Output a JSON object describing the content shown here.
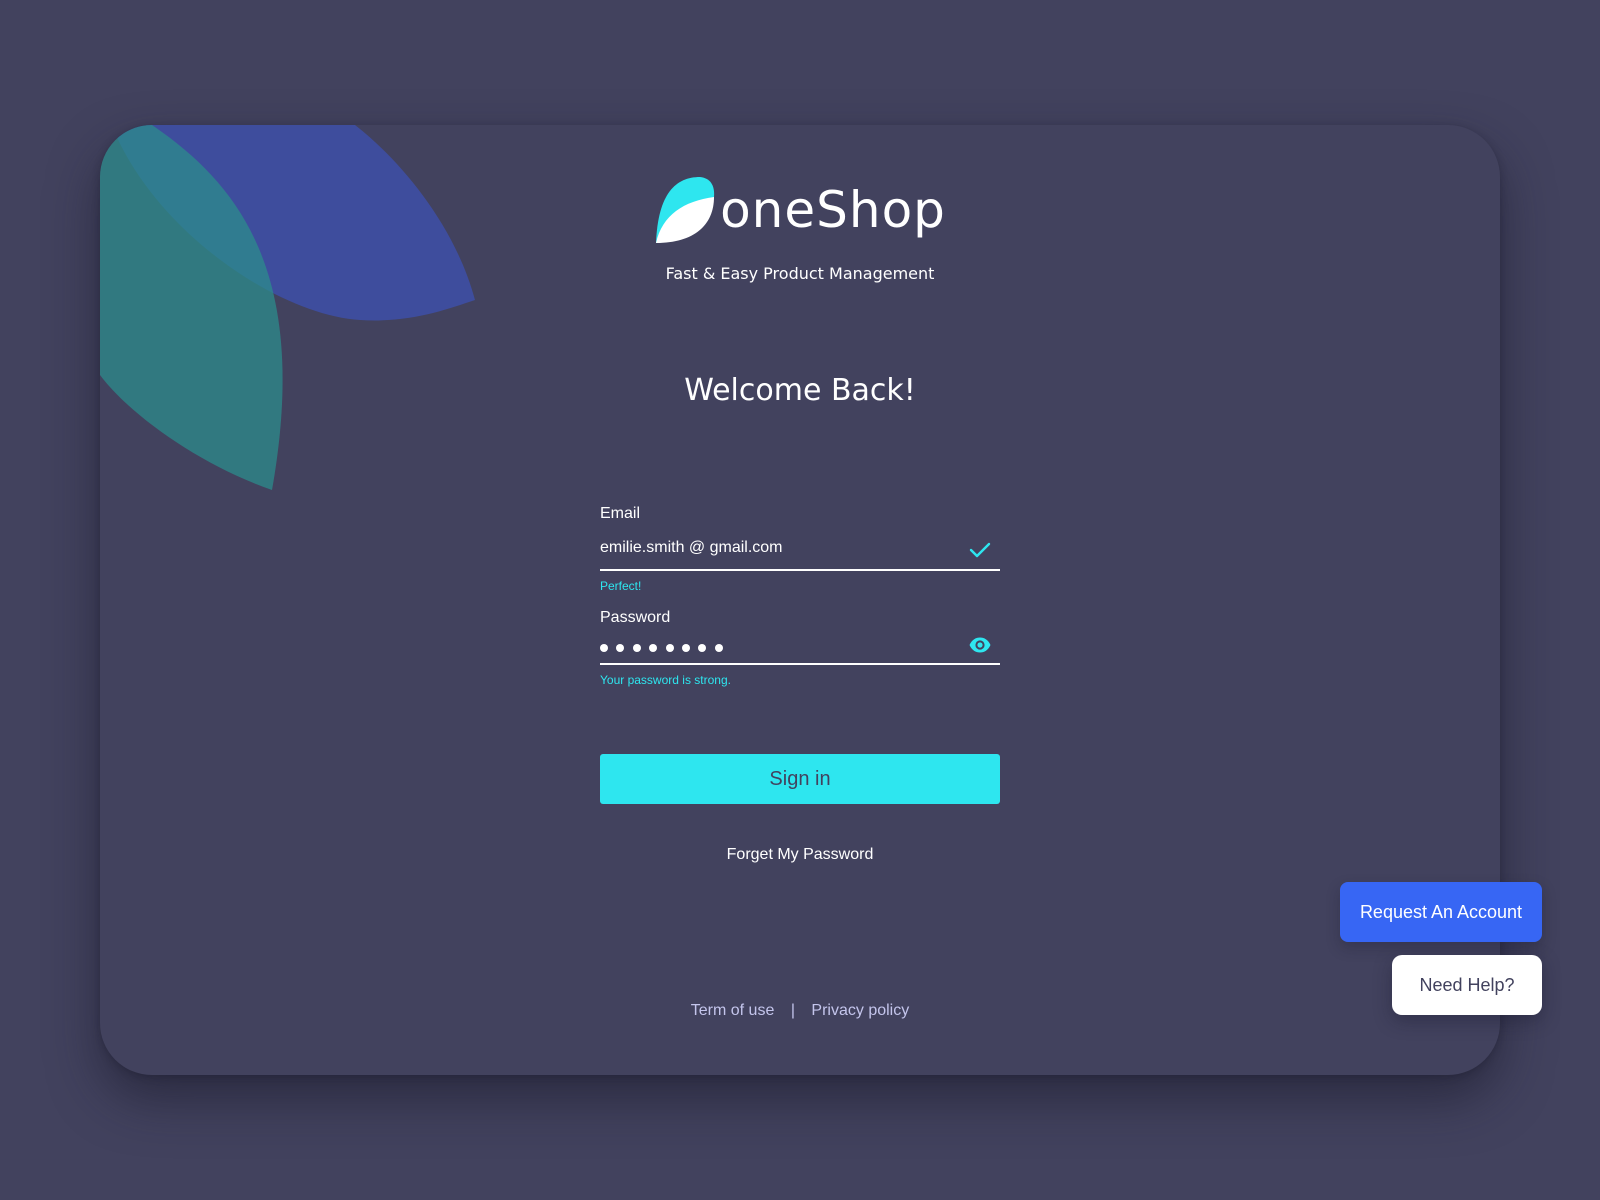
{
  "brand": {
    "name": "oneShop",
    "tagline": "Fast & Easy Product Management"
  },
  "welcome": "Welcome Back!",
  "form": {
    "email": {
      "label": "Email",
      "value": "emilie.smith @ gmail.com",
      "hint": "Perfect!",
      "icon": "checkmark-icon"
    },
    "password": {
      "label": "Password",
      "masked_length": 8,
      "hint": "Your password is strong.",
      "icon": "eye-icon"
    },
    "signin_label": "Sign in",
    "forgot_label": "Forget My Password"
  },
  "footer": {
    "terms": "Term of use",
    "separator": "|",
    "privacy": "Privacy policy"
  },
  "floating": {
    "request_label": "Request An Account",
    "help_label": "Need Help?"
  },
  "colors": {
    "background": "#42425e",
    "accent_cyan": "#2ee6ef",
    "button_blue": "#3766f4",
    "link_lavender": "#c4c5ec"
  }
}
